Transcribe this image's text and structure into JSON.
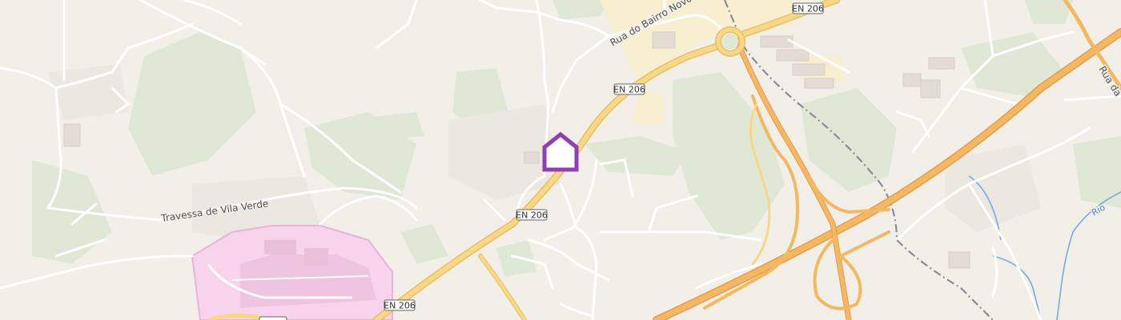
{
  "colors": {
    "background": "#f2efe9",
    "green_area": "#dfe8d5",
    "landuse_light": "#ebe8e2",
    "residential_yellow": "#f7efcf",
    "hospital_pink": "#f7d4ec",
    "hospital_outline": "#e8b4da",
    "highway_orange": "#f4b860",
    "primary_yellow": "#f8d888",
    "minor_road": "#ffffff",
    "railway": "#8b8b95",
    "water": "#7aa7e6",
    "marker": "#8e3fb3"
  },
  "road_shields": [
    {
      "id": "en206-1",
      "text": "EN 206"
    },
    {
      "id": "en206-2",
      "text": "EN 206"
    },
    {
      "id": "en206-3",
      "text": "EN 206"
    },
    {
      "id": "en206-4",
      "text": "EN 206"
    }
  ],
  "labels": {
    "rua_bairro_novo": "Rua do Bairro Novo",
    "travessa_vila_verde": "Travessa de Vila Verde",
    "rua_right": "Rua da",
    "river": "Rio"
  },
  "marker": {
    "icon": "home-icon"
  }
}
